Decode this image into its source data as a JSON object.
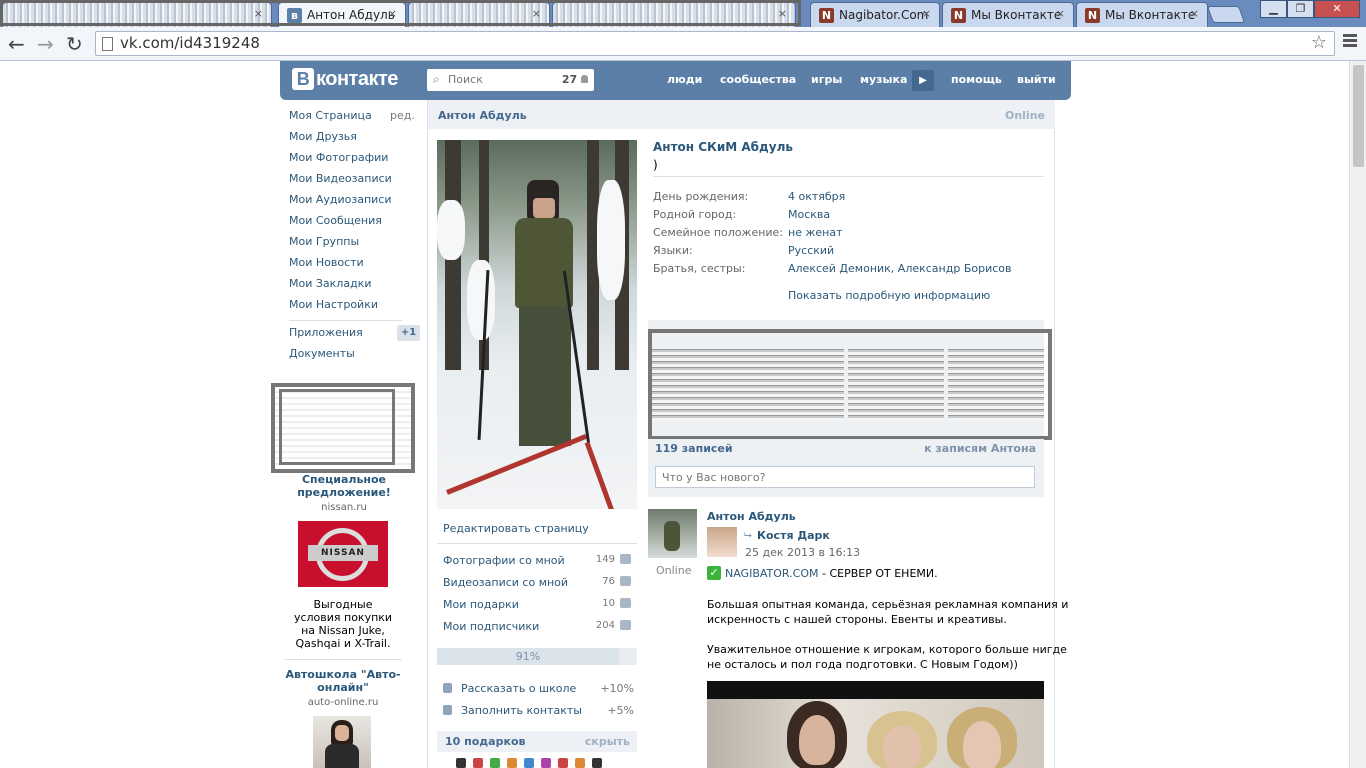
{
  "browser": {
    "tabs": [
      {
        "label": "",
        "blurred": true
      },
      {
        "label": "Антон Абдуль",
        "blurred": false,
        "active": true
      },
      {
        "label": "",
        "blurred": true
      },
      {
        "label": "",
        "blurred": true
      },
      {
        "label": "Nagibator.Com",
        "blurred": false
      },
      {
        "label": "Мы Вконтакте",
        "blurred": false
      },
      {
        "label": "Мы Вконтакте",
        "blurred": false
      }
    ],
    "tab_close_glyph": "×",
    "url": "vk.com/id4319248",
    "window_buttons": {
      "minimize": "▁",
      "maximize": "❐",
      "close": "✕"
    },
    "nav_icons": {
      "back": "←",
      "forward": "→",
      "reload": "↻",
      "star": "☆"
    }
  },
  "vk": {
    "logo_letter": "В",
    "logo_text": "контакте",
    "search_placeholder": "Поиск",
    "search_count": "27",
    "nav": [
      "люди",
      "сообщества",
      "игры",
      "музыка",
      "помощь",
      "выйти"
    ]
  },
  "left_menu": {
    "items": [
      "Моя Страница",
      "Мои Друзья",
      "Мои Фотографии",
      "Мои Видеозаписи",
      "Мои Аудиозаписи",
      "Мои Сообщения",
      "Мои Группы",
      "Мои Новости",
      "Мои Закладки",
      "Мои Настройки"
    ],
    "edit_label": "ред.",
    "apps_label": "Приложения",
    "apps_badge": "+1",
    "docs_label": "Документы"
  },
  "ads": [
    {
      "title": "Специальное предложение!",
      "domain": "nissan.ru",
      "logo_text": "NISSAN",
      "text": "Выгодные условия покупки на Nissan Juke, Qashqai и X-Trail."
    },
    {
      "title": "Автошкола \"Авто-онлайн\"",
      "domain": "auto-online.ru"
    }
  ],
  "profile": {
    "header_name": "Антон Абдуль",
    "header_status": "Online",
    "full_name": "Антон СКиМ Абдуль",
    "status_text": ")",
    "info": [
      {
        "label": "День рождения:",
        "value": "4 октября"
      },
      {
        "label": "Родной город:",
        "value": "Москва"
      },
      {
        "label": "Семейное положение:",
        "value": "не женат"
      },
      {
        "label": "Языки:",
        "value": "Русский"
      },
      {
        "label": "Братья, сестры:",
        "value": "Алексей Демоник, Александр Борисов"
      }
    ],
    "show_more": "Показать подробную информацию"
  },
  "sidebar": {
    "edit_page": "Редактировать страницу",
    "counters": [
      {
        "label": "Фотографии со мной",
        "count": "149"
      },
      {
        "label": "Видеозаписи со мной",
        "count": "76"
      },
      {
        "label": "Мои подарки",
        "count": "10"
      },
      {
        "label": "Мои подписчики",
        "count": "204"
      }
    ],
    "completion": "91%",
    "completion_value": 0.91,
    "tips": [
      {
        "label": "Рассказать о школе",
        "pct": "+10%"
      },
      {
        "label": "Заполнить контакты",
        "pct": "+5%"
      }
    ],
    "gifts_title": "10 подарков",
    "gifts_hide": "скрыть"
  },
  "wall": {
    "count_label": "119 записей",
    "to_posts": "к записям Антона",
    "input_placeholder": "Что у Вас нового?",
    "post": {
      "author": "Антон Абдуль",
      "author_status": "Online",
      "repost_author": "Костя Дарк",
      "date": "25 дек 2013 в 16:13",
      "check_glyph": "✓",
      "link_text": "NAGIBATOR.COM",
      "headline_rest": " - СЕРВЕР ОТ ЕНЕМИ.",
      "lines": [
        "Большая опытная команда, серьёзная рекламная компания и",
        "искренность с нашей стороны. Евенты и креативы.",
        "Уважительное отношение к игрокам, которого больше нигде",
        "не осталось и пол года подготовки. С Новым Годом))"
      ]
    }
  },
  "colors": {
    "brand": "#5b7fa6",
    "link": "#2b587a",
    "chrome": "#6a8bbd"
  }
}
